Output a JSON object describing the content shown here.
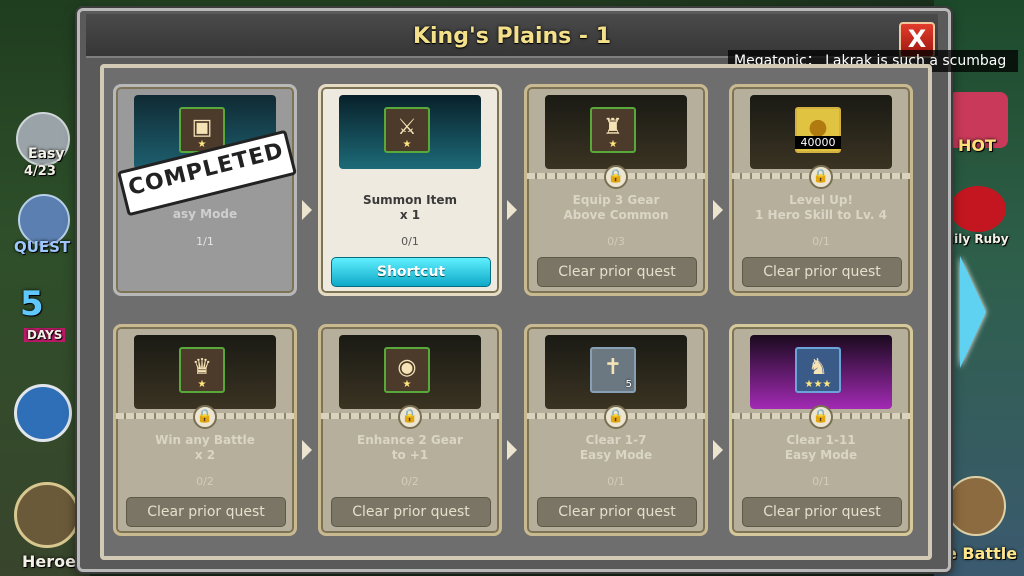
{
  "window": {
    "title": "King's Plains - 1",
    "close_label": "X"
  },
  "chat": {
    "message": "Megatonic： Lakrak is such a scumbag"
  },
  "side_left": {
    "difficulty": "Easy",
    "difficulty_progress": "4/23",
    "quest_label": "QUEST",
    "days_label": "5",
    "days_sub": "DAYS",
    "heroes_label": "Heroes"
  },
  "side_right": {
    "hot_label": "HOT",
    "daily_label": "aily Ruby",
    "battle_label": "e Battle"
  },
  "quests": [
    {
      "name": "Clear 1-5\nEasy Mode",
      "name_visible": "asy Mode",
      "progress": "1/1",
      "state": "completed",
      "stamp": "COMPLETED",
      "icon": "armor-icon",
      "stars": "★"
    },
    {
      "name": "Summon Item\nx 1",
      "progress": "0/1",
      "state": "active",
      "button": "Shortcut",
      "icon": "sword-icon",
      "stars": "★"
    },
    {
      "name": "Equip 3 Gear\nAbove Common",
      "progress": "0/3",
      "state": "locked",
      "button": "Clear prior quest",
      "icon": "cloak-icon",
      "stars": "★"
    },
    {
      "name": "Level Up!\n1 Hero Skill to Lv. 4",
      "progress": "0/1",
      "state": "locked",
      "button": "Clear prior quest",
      "icon": "gold-coin-icon",
      "amount": "40000"
    },
    {
      "name": "Win any Battle\nx 2",
      "progress": "0/2",
      "state": "locked",
      "button": "Clear prior quest",
      "icon": "chest-armor-icon",
      "stars": "★"
    },
    {
      "name": "Enhance 2 Gear\nto +1",
      "progress": "0/2",
      "state": "locked",
      "button": "Clear prior quest",
      "icon": "orb-icon",
      "stars": "★"
    },
    {
      "name": "Clear 1-7\nEasy Mode",
      "progress": "0/1",
      "state": "locked",
      "button": "Clear prior quest",
      "icon": "scroll-icon",
      "count": "5"
    },
    {
      "name": "Clear 1-11\nEasy Mode",
      "progress": "0/1",
      "state": "locked-purple",
      "button": "Clear prior quest",
      "icon": "boot-icon",
      "stars": "★★★"
    }
  ]
}
